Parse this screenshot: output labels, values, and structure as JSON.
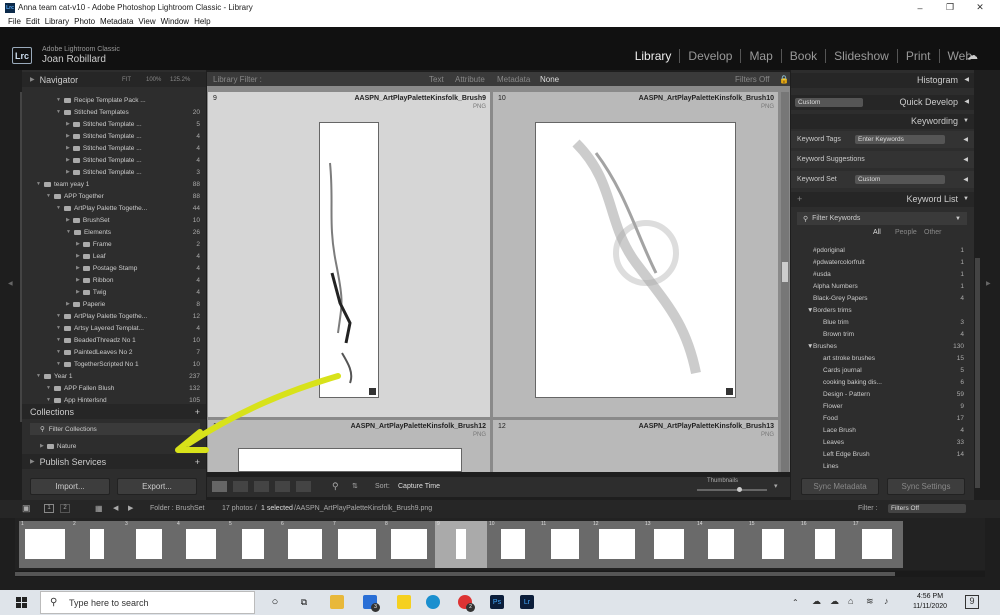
{
  "window": {
    "title": "Anna team cat-v10 - Adobe Photoshop Lightroom Classic - Library",
    "app_icon": "Lrc",
    "controls": [
      "–",
      "❐",
      "✕"
    ]
  },
  "menu": [
    "File",
    "Edit",
    "Library",
    "Photo",
    "Metadata",
    "View",
    "Window",
    "Help"
  ],
  "identity": {
    "badge": "Lrc",
    "product": "Adobe Lightroom Classic",
    "user": "Joan Robillard",
    "modules": [
      "Library",
      "Develop",
      "Map",
      "Book",
      "Slideshow",
      "Print",
      "Web"
    ],
    "active_module": "Library"
  },
  "left": {
    "navigator": {
      "title": "Navigator",
      "zoom": [
        "FIT",
        "100%",
        "125.2%"
      ]
    },
    "tree": [
      {
        "label": "Recipe Template Pack ...",
        "count": "",
        "indent": 3
      },
      {
        "label": "Stitched Templates",
        "count": "20",
        "indent": 3
      },
      {
        "label": "Stitched Template ...",
        "count": "5",
        "indent": 4
      },
      {
        "label": "Stitched Template ...",
        "count": "4",
        "indent": 4
      },
      {
        "label": "Stitched Template ...",
        "count": "4",
        "indent": 4
      },
      {
        "label": "Stitched Template ...",
        "count": "4",
        "indent": 4
      },
      {
        "label": "Stitched Template ...",
        "count": "3",
        "indent": 4
      },
      {
        "label": "team yeay 1",
        "count": "88",
        "indent": 1
      },
      {
        "label": "APP Together",
        "count": "88",
        "indent": 2
      },
      {
        "label": "ArtPlay Palette Togethe...",
        "count": "44",
        "indent": 3
      },
      {
        "label": "BrushSet",
        "count": "10",
        "indent": 4
      },
      {
        "label": "Elements",
        "count": "26",
        "indent": 4
      },
      {
        "label": "Frame",
        "count": "2",
        "indent": 5
      },
      {
        "label": "Leaf",
        "count": "4",
        "indent": 5
      },
      {
        "label": "Postage Stamp",
        "count": "4",
        "indent": 5
      },
      {
        "label": "Ribbon",
        "count": "4",
        "indent": 5
      },
      {
        "label": "Twig",
        "count": "4",
        "indent": 5
      },
      {
        "label": "Paperie",
        "count": "8",
        "indent": 4
      },
      {
        "label": "ArtPlay Palette Togethe...",
        "count": "12",
        "indent": 3
      },
      {
        "label": "Artsy Layered Templat...",
        "count": "4",
        "indent": 3
      },
      {
        "label": "BeadedThreadz No 1",
        "count": "10",
        "indent": 3
      },
      {
        "label": "PaintedLeaves No 2",
        "count": "7",
        "indent": 3
      },
      {
        "label": "TogetherScripted No 1",
        "count": "10",
        "indent": 3
      },
      {
        "label": "Year 1",
        "count": "237",
        "indent": 1
      },
      {
        "label": "APP Fallen Blush",
        "count": "132",
        "indent": 2
      },
      {
        "label": "App Hinterlsnd",
        "count": "105",
        "indent": 2
      }
    ],
    "collections": {
      "title": "Collections",
      "filter": "Filter Collections",
      "items": [
        "Nature"
      ]
    },
    "publish": "Publish Services",
    "import_label": "Import...",
    "export_label": "Export..."
  },
  "center": {
    "filter": {
      "label": "Library Filter :",
      "tabs": [
        "Text",
        "Attribute",
        "Metadata",
        "None"
      ],
      "status": "Filters Off"
    },
    "cells": [
      {
        "num": "9",
        "name": "AASPN_ArtPlayPaletteKinsfolk_Brush9",
        "type": "PNG"
      },
      {
        "num": "10",
        "name": "AASPN_ArtPlayPaletteKinsfolk_Brush10",
        "type": "PNG"
      },
      {
        "num": "11",
        "name": "AASPN_ArtPlayPaletteKinsfolk_Brush12",
        "type": "PNG"
      },
      {
        "num": "12",
        "name": "AASPN_ArtPlayPaletteKinsfolk_Brush13",
        "type": "PNG"
      }
    ],
    "toolbar": {
      "sort_label": "Sort:",
      "sort_value": "Capture Time",
      "thumbs_label": "Thumbnails"
    }
  },
  "right": {
    "histogram": "Histogram",
    "quick_develop": {
      "title": "Quick Develop",
      "preset": "Custom"
    },
    "keywording": {
      "title": "Keywording",
      "tags_label": "Keyword Tags",
      "tags_value": "Enter Keywords",
      "suggestions": "Keyword Suggestions",
      "set_label": "Keyword Set",
      "set_value": "Custom"
    },
    "keyword_list": {
      "title": "Keyword List",
      "filter": "Filter Keywords",
      "tabs": [
        "All",
        "People",
        "Other"
      ],
      "items": [
        {
          "label": "#pdoriginal",
          "count": "1",
          "indent": 1
        },
        {
          "label": "#pdwatercolorfruit",
          "count": "1",
          "indent": 1
        },
        {
          "label": "#usda",
          "count": "1",
          "indent": 1
        },
        {
          "label": "Alpha Numbers",
          "count": "1",
          "indent": 1
        },
        {
          "label": "Black-Grey Papers",
          "count": "4",
          "indent": 1
        },
        {
          "label": "Borders trims",
          "count": "",
          "indent": 1
        },
        {
          "label": "Blue trim",
          "count": "3",
          "indent": 2
        },
        {
          "label": "Brown trim",
          "count": "4",
          "indent": 2
        },
        {
          "label": "Brushes",
          "count": "130",
          "indent": 1
        },
        {
          "label": "art stroke brushes",
          "count": "15",
          "indent": 2
        },
        {
          "label": "Cards journal",
          "count": "5",
          "indent": 2
        },
        {
          "label": "cooking baking dis...",
          "count": "6",
          "indent": 2
        },
        {
          "label": "Design - Pattern",
          "count": "59",
          "indent": 2
        },
        {
          "label": "Flower",
          "count": "9",
          "indent": 2
        },
        {
          "label": "Food",
          "count": "17",
          "indent": 2
        },
        {
          "label": "Lace Brush",
          "count": "4",
          "indent": 2
        },
        {
          "label": "Leaves",
          "count": "33",
          "indent": 2
        },
        {
          "label": "Left Edge Brush",
          "count": "14",
          "indent": 2
        },
        {
          "label": "Lines",
          "count": "",
          "indent": 2
        }
      ]
    },
    "sync_metadata": "Sync Metadata",
    "sync_settings": "Sync Settings"
  },
  "filmstrip_bar": {
    "pages": [
      "1",
      "2"
    ],
    "folder": "Folder : BrushSet",
    "photos": "17 photos /",
    "selected": "1 selected",
    "path": "/AASPN_ArtPlayPaletteKinsfolk_Brush9.png",
    "filter_label": "Filter :",
    "filter_value": "Filters Off"
  },
  "filmstrip": [
    "1",
    "2",
    "3",
    "4",
    "5",
    "6",
    "7",
    "8",
    "9",
    "10",
    "11",
    "12",
    "13",
    "14",
    "15",
    "16",
    "17"
  ],
  "taskbar": {
    "search_placeholder": "Type here to search",
    "time": "4:56 PM",
    "date": "11/11/2020",
    "notifications": "9",
    "badges": [
      "3",
      "2"
    ]
  },
  "annotation_color": "#d8e21a"
}
